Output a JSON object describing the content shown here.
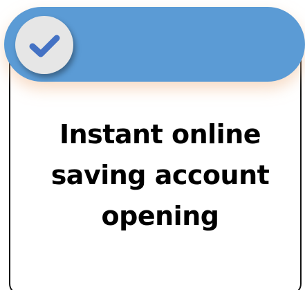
{
  "card": {
    "title": "Instant online saving account opening",
    "icon": "checkmark-icon"
  },
  "colors": {
    "banner": "#5b9bd5",
    "check": "#4472c4",
    "badge": "#e6e6e6"
  }
}
